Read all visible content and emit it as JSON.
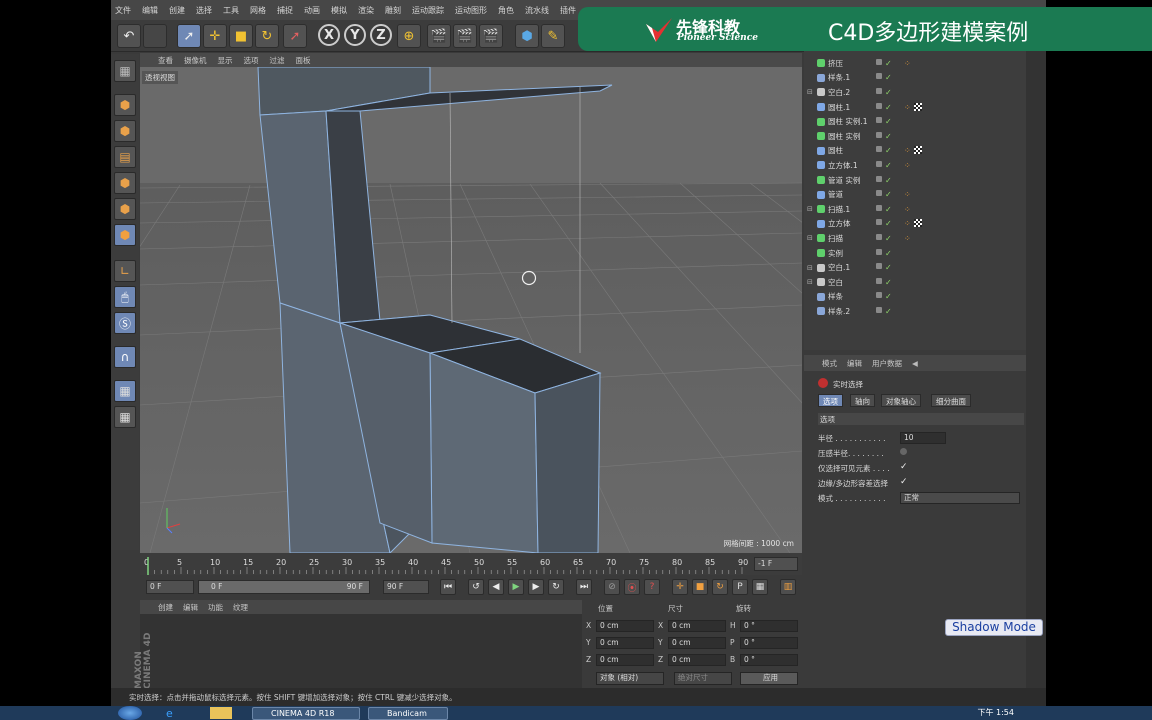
{
  "menubar": [
    "文件",
    "编辑",
    "创建",
    "选择",
    "工具",
    "网格",
    "捕捉",
    "动画",
    "模拟",
    "渲染",
    "雕刻",
    "运动跟踪",
    "运动图形",
    "角色",
    "流水线",
    "插件"
  ],
  "banner": {
    "logo_cn": "先锋科教",
    "logo_en": "Pioneer Science",
    "title": "C4D多边形建模案例"
  },
  "viewport": {
    "menu": [
      "查看",
      "摄像机",
      "显示",
      "选项",
      "过滤",
      "面板"
    ],
    "label": "透视视图",
    "grid_info": "网格间距 : 1000 cm"
  },
  "timeline": {
    "ticks": [
      "0",
      "5",
      "10",
      "15",
      "20",
      "25",
      "30",
      "35",
      "40",
      "45",
      "50",
      "55",
      "60",
      "65",
      "70",
      "75",
      "80",
      "85",
      "90"
    ],
    "frame_right": "-1 F"
  },
  "transport": {
    "start": "0 F",
    "slider_left": "0 F",
    "slider_right": "90 F",
    "end": "90 F"
  },
  "material": {
    "menu": [
      "创建",
      "编辑",
      "功能",
      "纹理"
    ]
  },
  "coords": {
    "headers": {
      "position": "位置",
      "size": "尺寸",
      "rotation": "旋转"
    },
    "rows": [
      {
        "a": "X",
        "av": "0 cm",
        "b": "X",
        "bv": "0 cm",
        "c": "H",
        "cv": "0 °"
      },
      {
        "a": "Y",
        "av": "0 cm",
        "b": "Y",
        "bv": "0 cm",
        "c": "P",
        "cv": "0 °"
      },
      {
        "a": "Z",
        "av": "0 cm",
        "b": "Z",
        "bv": "0 cm",
        "c": "B",
        "cv": "0 °"
      }
    ],
    "mode": "对象 (相对)",
    "size_mode": "绝对尺寸",
    "apply": "应用"
  },
  "objects": [
    {
      "name": "挤压",
      "color": "#5fd06c",
      "indent": 0,
      "tag": true
    },
    {
      "name": "样条.1",
      "color": "#8aa7d8",
      "indent": 0
    },
    {
      "name": "空白.2",
      "color": "#c9c9c9",
      "indent": 0,
      "expand": true
    },
    {
      "name": "圆柱.1",
      "color": "#7fa8e6",
      "indent": 0,
      "tag": true,
      "check": true
    },
    {
      "name": "圆柱 实例.1",
      "color": "#5fd06c",
      "indent": 0
    },
    {
      "name": "圆柱 实例",
      "color": "#5fd06c",
      "indent": 0
    },
    {
      "name": "圆柱",
      "color": "#7fa8e6",
      "indent": 0,
      "tag": true,
      "check": true
    },
    {
      "name": "立方体.1",
      "color": "#7fa8e6",
      "indent": 0,
      "tag": true
    },
    {
      "name": "管道 实例",
      "color": "#5fd06c",
      "indent": 0
    },
    {
      "name": "管道",
      "color": "#7fa8e6",
      "indent": 0,
      "tag": true
    },
    {
      "name": "扫描.1",
      "color": "#5fd06c",
      "indent": 0,
      "expand": true,
      "tag": true
    },
    {
      "name": "立方体",
      "color": "#7fa8e6",
      "indent": 0,
      "tag": true,
      "check": true
    },
    {
      "name": "扫描",
      "color": "#5fd06c",
      "indent": 0,
      "expand": true,
      "tag": true
    },
    {
      "name": "实例",
      "color": "#5fd06c",
      "indent": 0
    },
    {
      "name": "空白.1",
      "color": "#c9c9c9",
      "indent": 0,
      "expand": true
    },
    {
      "name": "空白",
      "color": "#c9c9c9",
      "indent": 0,
      "expand": true
    },
    {
      "name": "样条",
      "color": "#8aa7d8",
      "indent": 0
    },
    {
      "name": "样条.2",
      "color": "#8aa7d8",
      "indent": 0
    }
  ],
  "attributes": {
    "menu": [
      "模式",
      "编辑",
      "用户数据"
    ],
    "tool_name": "实时选择",
    "tabs": [
      "选项",
      "轴向",
      "对象轴心",
      "细分曲面"
    ],
    "section": "选项",
    "fields": [
      {
        "label": "半径 . . . . . . . . . . .",
        "value": "10"
      },
      {
        "label": "压感半径. . . . . . . .",
        "value": ""
      },
      {
        "label": "仅选择可见元素 . . . .",
        "value": "✓"
      },
      {
        "label": "边缘/多边形容差选择",
        "value": "✓"
      },
      {
        "label": "模式 . . . . . . . . . . .",
        "value": "正常"
      }
    ]
  },
  "status": "实时选择：点击并拖动鼠标选择元素。按住 SHIFT 键增加选择对象；按住 CTRL 键减少选择对象。",
  "shadow_mode": "Shadow Mode",
  "taskbar": {
    "items": [
      "CINEMA 4D R18",
      "Bandicam"
    ],
    "clock": "下午 1:54"
  },
  "maxon": "MAXON\nCINEMA 4D"
}
